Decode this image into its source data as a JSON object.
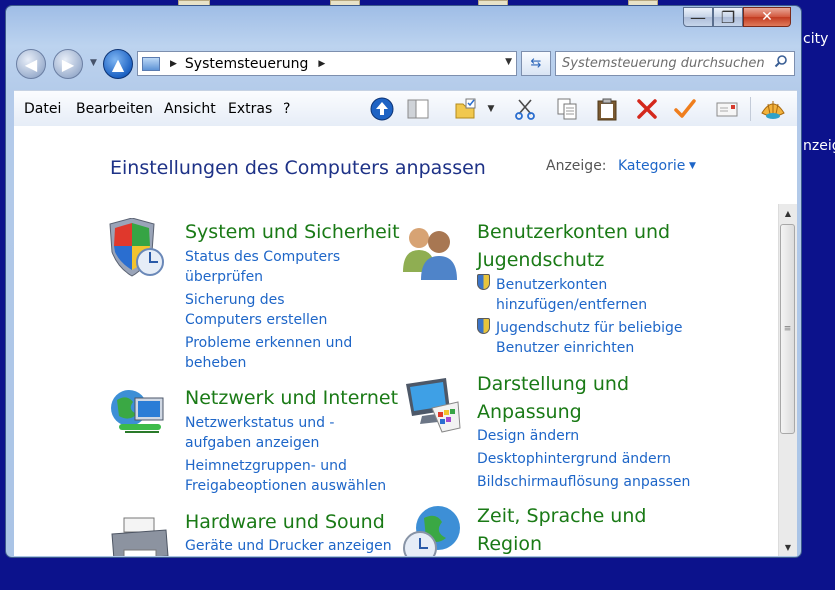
{
  "desktop": {
    "item_1_label": "city",
    "item_2_label": "nzeig"
  },
  "window": {
    "controls": {
      "minimize": "—",
      "maximize": "❐",
      "close": "✕"
    }
  },
  "navigation": {
    "back_glyph": "◀",
    "forward_glyph": "▶",
    "history_glyph": "▼",
    "up_glyph": "▲",
    "address": {
      "separator": "▶",
      "location": "Systemsteuerung",
      "separator_after": "▶",
      "dropdown": "▼"
    },
    "refresh_glyph": "⇆",
    "search": {
      "placeholder": "Systemsteuerung durchsuchen",
      "value": ""
    }
  },
  "menu": {
    "items": [
      "Datei",
      "Bearbeiten",
      "Ansicht",
      "Extras",
      "?"
    ]
  },
  "toolbar": {
    "icons": [
      "up-icon",
      "panel-icon",
      "folder-icon",
      "cut-icon",
      "copy-icon",
      "paste-icon",
      "delete-icon",
      "check-icon",
      "mail-icon",
      "shell-icon"
    ],
    "dropdown_glyph": "▼"
  },
  "content": {
    "title": "Einstellungen des Computers anpassen",
    "view": {
      "label": "Anzeige:",
      "value": "Kategorie",
      "arrow": "▼"
    },
    "categories": [
      {
        "title": "System und Sicherheit",
        "icon": "shield-computer-icon",
        "tasks": [
          "Status des Computers überprüfen",
          "Sicherung des Computers erstellen",
          "Probleme erkennen und beheben"
        ]
      },
      {
        "title": "Benutzerkonten und Jugendschutz",
        "icon": "users-icon",
        "tasks": [
          "Benutzerkonten hinzufügen/entfernen",
          "Jugendschutz für beliebige Benutzer einrichten"
        ]
      },
      {
        "title": "Netzwerk und Internet",
        "icon": "network-icon",
        "tasks": [
          "Netzwerkstatus und -aufgaben anzeigen",
          "Heimnetzgruppen- und Freigabeoptionen auswählen"
        ]
      },
      {
        "title": "Darstellung und Anpassung",
        "icon": "display-icon",
        "tasks": [
          "Design ändern",
          "Desktophintergrund ändern",
          "Bildschirmauflösung anpassen"
        ]
      },
      {
        "title": "Hardware und Sound",
        "icon": "printer-icon",
        "tasks": [
          "Geräte und Drucker anzeigen"
        ]
      },
      {
        "title": "Zeit, Sprache und Region",
        "icon": "globe-clock-icon",
        "tasks": []
      }
    ]
  },
  "scrollbar": {
    "up": "▲",
    "down": "▼",
    "grip": "≡"
  },
  "colors": {
    "link": "#1e66c8",
    "category": "#1a7a16",
    "title": "#1e3287",
    "desktop": "#0c128c"
  }
}
